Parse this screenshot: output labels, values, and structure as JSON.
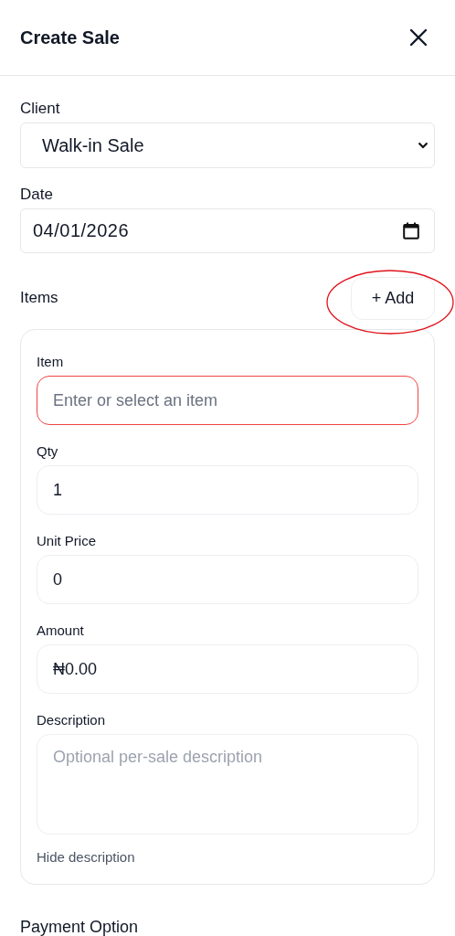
{
  "dialog": {
    "title": "Create Sale"
  },
  "client": {
    "label": "Client",
    "value": "Walk-in Sale"
  },
  "date": {
    "label": "Date",
    "value": "04/01/2026"
  },
  "items": {
    "label": "Items",
    "add_button": {
      "label": "+ Add",
      "circled": true
    },
    "fields": [
      {
        "kind": "input",
        "label": "Item",
        "placeholder": "Enter or select an item",
        "error": true
      },
      {
        "kind": "input",
        "label": "Qty",
        "value": "1",
        "error": false
      },
      {
        "kind": "input",
        "label": "Unit Price",
        "value": "0",
        "error": false
      },
      {
        "kind": "input",
        "label": "Amount",
        "value": "₦0.00",
        "error": false
      },
      {
        "kind": "textarea",
        "label": "Description",
        "placeholder": "Optional per-sale description",
        "error": false
      }
    ],
    "toggle_link": "Hide description"
  },
  "payment": {
    "label": "Payment Option"
  }
}
